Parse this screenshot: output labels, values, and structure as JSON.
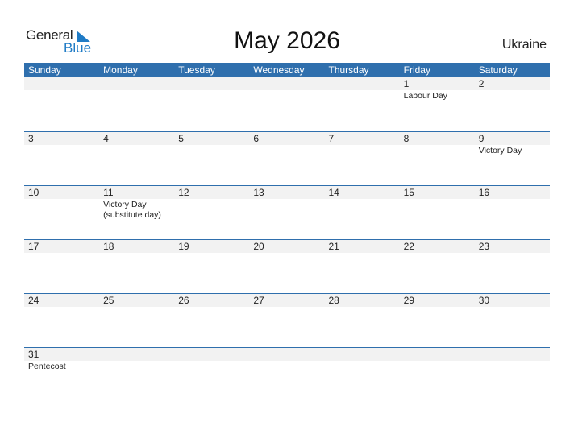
{
  "logo": {
    "line1": "General",
    "line2": "Blue"
  },
  "title": "May 2026",
  "country": "Ukraine",
  "colors": {
    "header_bg": "#2f6fad",
    "brand_blue": "#1f7bc6",
    "date_band": "#f2f2f2"
  },
  "weekdays": [
    "Sunday",
    "Monday",
    "Tuesday",
    "Wednesday",
    "Thursday",
    "Friday",
    "Saturday"
  ],
  "weeks": [
    [
      {
        "d": "",
        "h": ""
      },
      {
        "d": "",
        "h": ""
      },
      {
        "d": "",
        "h": ""
      },
      {
        "d": "",
        "h": ""
      },
      {
        "d": "",
        "h": ""
      },
      {
        "d": "1",
        "h": "Labour Day"
      },
      {
        "d": "2",
        "h": ""
      }
    ],
    [
      {
        "d": "3",
        "h": ""
      },
      {
        "d": "4",
        "h": ""
      },
      {
        "d": "5",
        "h": ""
      },
      {
        "d": "6",
        "h": ""
      },
      {
        "d": "7",
        "h": ""
      },
      {
        "d": "8",
        "h": ""
      },
      {
        "d": "9",
        "h": "Victory Day"
      }
    ],
    [
      {
        "d": "10",
        "h": ""
      },
      {
        "d": "11",
        "h": "Victory Day (substitute day)"
      },
      {
        "d": "12",
        "h": ""
      },
      {
        "d": "13",
        "h": ""
      },
      {
        "d": "14",
        "h": ""
      },
      {
        "d": "15",
        "h": ""
      },
      {
        "d": "16",
        "h": ""
      }
    ],
    [
      {
        "d": "17",
        "h": ""
      },
      {
        "d": "18",
        "h": ""
      },
      {
        "d": "19",
        "h": ""
      },
      {
        "d": "20",
        "h": ""
      },
      {
        "d": "21",
        "h": ""
      },
      {
        "d": "22",
        "h": ""
      },
      {
        "d": "23",
        "h": ""
      }
    ],
    [
      {
        "d": "24",
        "h": ""
      },
      {
        "d": "25",
        "h": ""
      },
      {
        "d": "26",
        "h": ""
      },
      {
        "d": "27",
        "h": ""
      },
      {
        "d": "28",
        "h": ""
      },
      {
        "d": "29",
        "h": ""
      },
      {
        "d": "30",
        "h": ""
      }
    ],
    [
      {
        "d": "31",
        "h": "Pentecost"
      },
      {
        "d": "",
        "h": ""
      },
      {
        "d": "",
        "h": ""
      },
      {
        "d": "",
        "h": ""
      },
      {
        "d": "",
        "h": ""
      },
      {
        "d": "",
        "h": ""
      },
      {
        "d": "",
        "h": ""
      }
    ]
  ]
}
